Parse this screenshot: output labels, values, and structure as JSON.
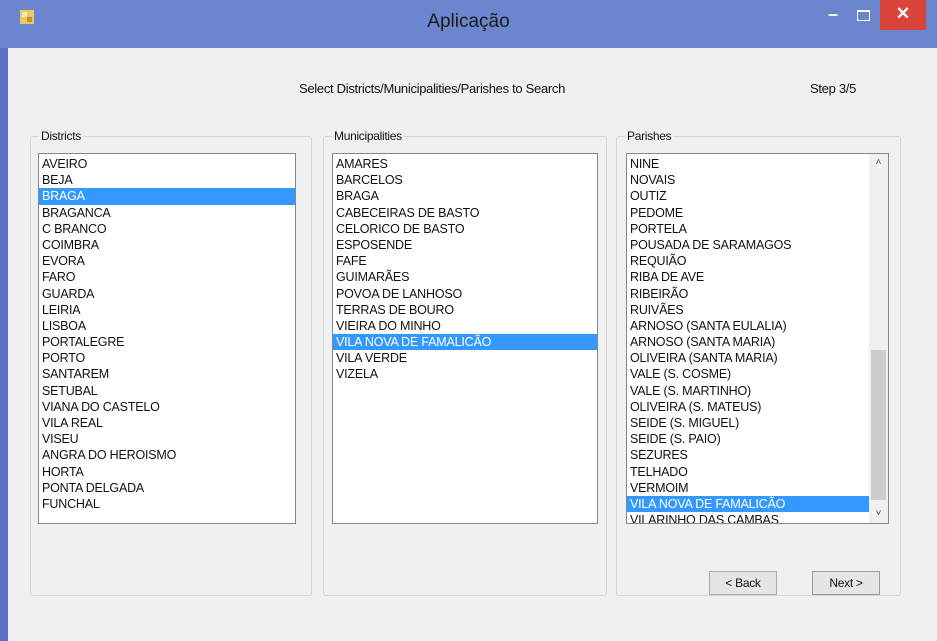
{
  "window": {
    "title": "Aplicação",
    "minimize": "–",
    "close": "✕"
  },
  "header": {
    "prompt": "Select Districts/Municipalities/Parishes to Search",
    "step": "Step 3/5"
  },
  "districts": {
    "label": "Districts",
    "items": [
      "AVEIRO",
      "BEJA",
      "BRAGA",
      "BRAGANCA",
      "C BRANCO",
      "COIMBRA",
      "EVORA",
      "FARO",
      "GUARDA",
      "LEIRIA",
      "LISBOA",
      "PORTALEGRE",
      "PORTO",
      "SANTAREM",
      "SETUBAL",
      "VIANA DO CASTELO",
      "VILA REAL",
      "VISEU",
      "ANGRA DO HEROISMO",
      "HORTA",
      "PONTA DELGADA",
      "FUNCHAL"
    ],
    "selected": "BRAGA"
  },
  "municipalities": {
    "label": "Municipalities",
    "items": [
      "AMARES",
      "BARCELOS",
      "BRAGA",
      "CABECEIRAS DE BASTO",
      "CELORICO DE BASTO",
      "ESPOSENDE",
      "FAFE",
      "GUIMARÃES",
      "POVOA DE LANHOSO",
      "TERRAS DE BOURO",
      "VIEIRA DO MINHO",
      "VILA NOVA DE FAMALICÃO",
      "VILA VERDE",
      "VIZELA"
    ],
    "selected": "VILA NOVA DE FAMALICÃO"
  },
  "parishes": {
    "label": "Parishes",
    "items": [
      "NINE",
      "NOVAIS",
      "OUTIZ",
      "PEDOME",
      "PORTELA",
      "POUSADA DE SARAMAGOS",
      "REQUIÃO",
      "RIBA DE AVE",
      "RIBEIRÃO",
      "RUIVÃES",
      "ARNOSO (SANTA EULALIA)",
      "ARNOSO (SANTA MARIA)",
      "OLIVEIRA (SANTA MARIA)",
      "VALE (S. COSME)",
      "VALE (S. MARTINHO)",
      "OLIVEIRA (S. MATEUS)",
      "SEIDE (S. MIGUEL)",
      "SEIDE (S. PAIO)",
      "SEZURES",
      "TELHADO",
      "VERMOIM",
      "VILA NOVA DE FAMALICÃO",
      "VILARINHO DAS CAMBAS"
    ],
    "selected": "VILA NOVA DE FAMALICÃO",
    "scroll_up": "˄",
    "scroll_down": "˅"
  },
  "buttons": {
    "back": "< Back",
    "next": "Next >"
  },
  "colors": {
    "selection": "#3399ff",
    "titlebar": "#6b86cf",
    "close": "#d9453b"
  },
  "icons": {
    "app": "app-icon",
    "minimize": "minimize-icon",
    "maximize": "maximize-icon",
    "close": "close-icon",
    "scroll_up": "chevron-up-icon",
    "scroll_down": "chevron-down-icon"
  }
}
